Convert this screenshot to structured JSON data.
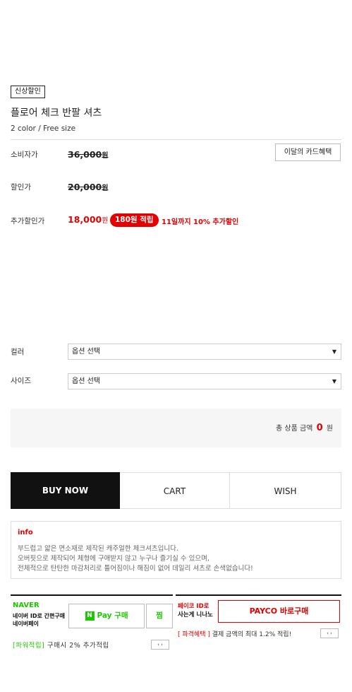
{
  "product": {
    "badge": "신상할인",
    "title": "플로어 체크 반팔 셔츠",
    "options_summary": "2 color / Free size"
  },
  "pricing": {
    "consumer_label": "소비자가",
    "consumer_price": "36,000",
    "sale_label": "할인가",
    "sale_price": "20,000",
    "extra_label": "추가할인가",
    "final_price": "18,000",
    "won": "원",
    "point_badge": "180원 적립",
    "extra_discount_text": "11일까지 10% 추가할인",
    "card_benefit_button": "이달의 카드혜택"
  },
  "options": {
    "color_label": "컬러",
    "color_value": "옵션 선택",
    "size_label": "사이즈",
    "size_value": "옵션 선택",
    "arrow_icon": "▼"
  },
  "total": {
    "label": "총 상품 금액",
    "amount": "0",
    "unit": "원"
  },
  "actions": {
    "buy_now": "BUY NOW",
    "cart": "CART",
    "wish": "WISH"
  },
  "info": {
    "title": "info",
    "lines": [
      "부드럽고 얇은 면소재로 제작된 캐주얼한 체크셔츠입니다.",
      "오버핏으로 제작되어 체형에 구애받지 않고 누구나 즐기실 수 있으며,",
      "전체적으로 탄탄한 마감처리로 틀어짐이나 해짐이 없어 데일리 셔츠로 손색없습니다!"
    ]
  },
  "naver_pay": {
    "logo": "NAVER",
    "desc_line1": "네이버 ID로 간편구매",
    "desc_line2": "네이버페이",
    "n_mark": "N",
    "pay_button": "Pay 구매",
    "zzim_button": "찜",
    "footer_tag": "[파워적립]",
    "footer_text": "구매시 2% 추가적립",
    "nav_arrows": "‹ ›"
  },
  "payco": {
    "desc_line1": "페이코 ID로",
    "desc_line2": "사는게 니나노",
    "button": "PAYCO 바로구매",
    "footer_tag": "[ 파격혜택 ]",
    "footer_text": "결제 금액의 최대 1.2% 적립!",
    "nav_arrows": "‹ ›"
  },
  "colors": {
    "accent_red": "#e30000",
    "naver_green": "#1ec800",
    "buy_black": "#111111"
  }
}
